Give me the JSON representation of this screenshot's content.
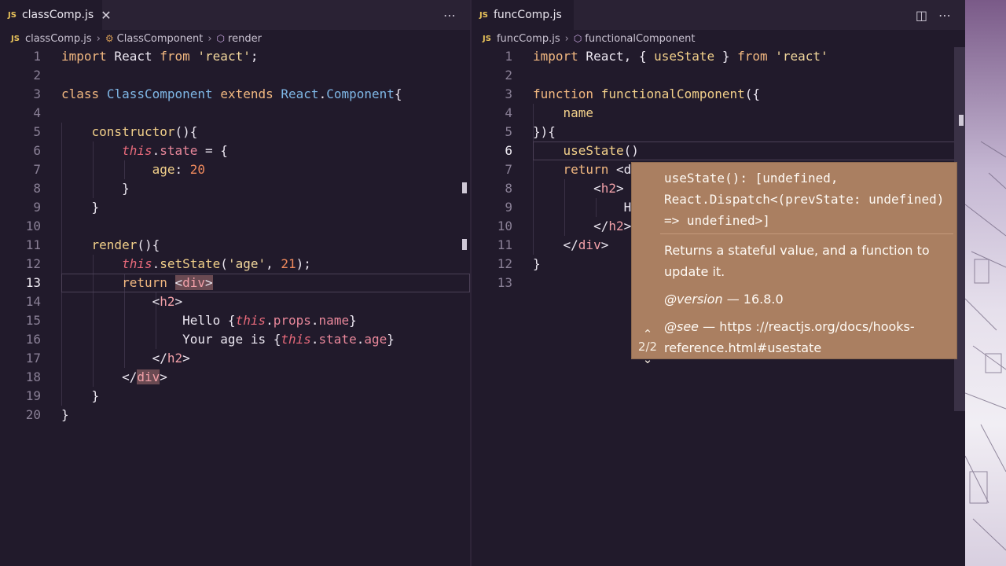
{
  "left_editor": {
    "tab": {
      "badge": "JS",
      "filename": "classComp.js",
      "close_glyph": "✕"
    },
    "more_glyph": "⋯",
    "breadcrumb": {
      "file": "classComp.js",
      "class": "ClassComponent",
      "method": "render"
    },
    "lines": [
      [
        [
          "kw",
          "import"
        ],
        [
          "plain",
          " React "
        ],
        [
          "kw",
          "from"
        ],
        [
          "plain",
          " "
        ],
        [
          "str",
          "'react'"
        ],
        [
          "plain",
          ";"
        ]
      ],
      [],
      [
        [
          "kw",
          "class"
        ],
        [
          "plain",
          " "
        ],
        [
          "cls",
          "ClassComponent"
        ],
        [
          "plain",
          " "
        ],
        [
          "kw",
          "extends"
        ],
        [
          "plain",
          " "
        ],
        [
          "cls",
          "React"
        ],
        [
          "plain",
          "."
        ],
        [
          "cls",
          "Component"
        ],
        [
          "plain",
          "{"
        ]
      ],
      [],
      [
        [
          "plain",
          "    "
        ],
        [
          "fn",
          "constructor"
        ],
        [
          "plain",
          "(){"
        ]
      ],
      [
        [
          "plain",
          "        "
        ],
        [
          "this",
          "this"
        ],
        [
          "plain",
          "."
        ],
        [
          "field",
          "state"
        ],
        [
          "plain",
          " = {"
        ]
      ],
      [
        [
          "plain",
          "            "
        ],
        [
          "prop",
          "age"
        ],
        [
          "plain",
          ": "
        ],
        [
          "num",
          "20"
        ]
      ],
      [
        [
          "plain",
          "        }"
        ]
      ],
      [
        [
          "plain",
          "    }"
        ]
      ],
      [],
      [
        [
          "plain",
          "    "
        ],
        [
          "fn",
          "render"
        ],
        [
          "plain",
          "(){"
        ]
      ],
      [
        [
          "plain",
          "        "
        ],
        [
          "this",
          "this"
        ],
        [
          "plain",
          "."
        ],
        [
          "fn",
          "setState"
        ],
        [
          "plain",
          "("
        ],
        [
          "str",
          "'age'"
        ],
        [
          "plain",
          ", "
        ],
        [
          "num",
          "21"
        ],
        [
          "plain",
          ");"
        ]
      ],
      [
        [
          "plain",
          "        "
        ],
        [
          "kw",
          "return"
        ],
        [
          "plain",
          " "
        ],
        [
          "tagmatch",
          "<"
        ],
        [
          "tagmatch-tag",
          "div"
        ],
        [
          "tagmatch",
          ">"
        ]
      ],
      [
        [
          "plain",
          "            <"
        ],
        [
          "tag",
          "h2"
        ],
        [
          "plain",
          ">"
        ]
      ],
      [
        [
          "plain",
          "                Hello {"
        ],
        [
          "this",
          "this"
        ],
        [
          "plain",
          "."
        ],
        [
          "field",
          "props"
        ],
        [
          "plain",
          "."
        ],
        [
          "field",
          "name"
        ],
        [
          "plain",
          "}"
        ]
      ],
      [
        [
          "plain",
          "                Your age is {"
        ],
        [
          "this",
          "this"
        ],
        [
          "plain",
          "."
        ],
        [
          "field",
          "state"
        ],
        [
          "plain",
          "."
        ],
        [
          "field",
          "age"
        ],
        [
          "plain",
          "}"
        ]
      ],
      [
        [
          "plain",
          "            </"
        ],
        [
          "tag",
          "h2"
        ],
        [
          "plain",
          ">"
        ]
      ],
      [
        [
          "plain",
          "        </"
        ],
        [
          "tagmatch-tag",
          "div"
        ],
        [
          "plain",
          ">"
        ]
      ],
      [
        [
          "plain",
          "    }"
        ]
      ],
      [
        [
          "plain",
          "}"
        ]
      ]
    ],
    "active_line": 13
  },
  "right_editor": {
    "tab": {
      "badge": "JS",
      "filename": "funcComp.js",
      "modified": true
    },
    "split_glyph": "◫",
    "more_glyph": "⋯",
    "breadcrumb": {
      "file": "funcComp.js",
      "function": "functionalComponent"
    },
    "lines": [
      [
        [
          "kw",
          "import"
        ],
        [
          "plain",
          " React, { "
        ],
        [
          "fn",
          "useState"
        ],
        [
          "plain",
          " } "
        ],
        [
          "kw",
          "from"
        ],
        [
          "plain",
          " "
        ],
        [
          "str",
          "'react'"
        ]
      ],
      [],
      [
        [
          "kw",
          "function"
        ],
        [
          "plain",
          " "
        ],
        [
          "fn",
          "functionalComponent"
        ],
        [
          "plain",
          "({"
        ]
      ],
      [
        [
          "plain",
          "    "
        ],
        [
          "prop",
          "name"
        ]
      ],
      [
        [
          "plain",
          "}){"
        ]
      ],
      [
        [
          "plain",
          "    "
        ],
        [
          "fn",
          "useState"
        ],
        [
          "plain",
          "()"
        ]
      ],
      [
        [
          "plain",
          "    "
        ],
        [
          "kw",
          "return"
        ],
        [
          "plain",
          " <d"
        ]
      ],
      [
        [
          "plain",
          "        <"
        ],
        [
          "tag",
          "h2"
        ],
        [
          "plain",
          ">"
        ]
      ],
      [
        [
          "plain",
          "            H"
        ]
      ],
      [
        [
          "plain",
          "        </"
        ],
        [
          "tag",
          "h2"
        ],
        [
          "plain",
          ">"
        ]
      ],
      [
        [
          "plain",
          "    </"
        ],
        [
          "tag",
          "div"
        ],
        [
          "plain",
          ">"
        ]
      ],
      [
        [
          "plain",
          "}"
        ]
      ],
      []
    ],
    "active_line": 6
  },
  "hover_widget": {
    "signature_lines": [
      "useState(): [undefined,",
      "React.Dispatch<(prevState: undefined)",
      "=> undefined>]"
    ],
    "description_lines": [
      "Returns a stateful value, and a function to",
      "update it."
    ],
    "version_label": "@version",
    "version_value": "— 16.8.0",
    "see_label": "@see",
    "see_lines": [
      "— https ://reactjs.org/docs/hooks-",
      "reference.html#usestate"
    ],
    "pager": {
      "up": "⌃",
      "count": "2/2",
      "down": "⌄"
    }
  },
  "colors": {
    "editor_bg": "#211a2b",
    "hover_bg": "#aa7f61",
    "keyword": "#f2b880",
    "class": "#7fb7e6",
    "this": "#e86a7b"
  }
}
